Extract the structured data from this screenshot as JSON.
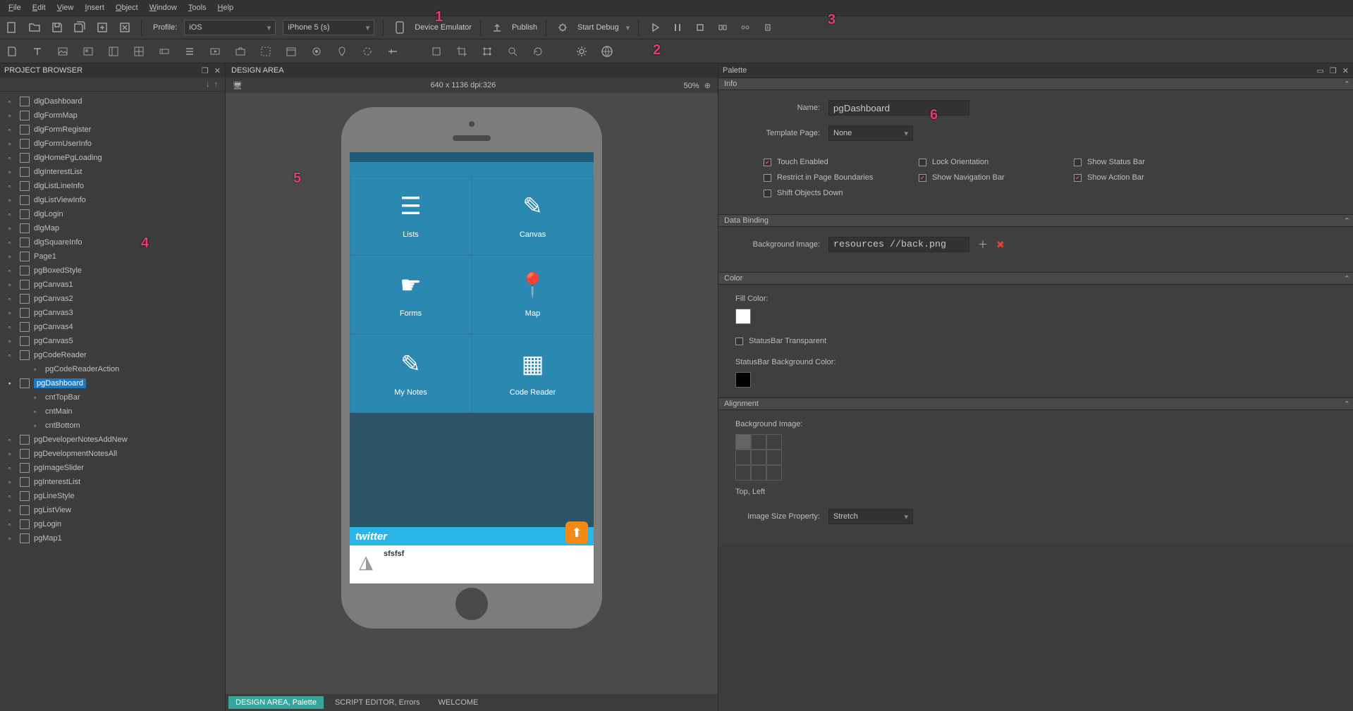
{
  "menubar": [
    "File",
    "Edit",
    "View",
    "Insert",
    "Object",
    "Window",
    "Tools",
    "Help"
  ],
  "toolbar": {
    "profile_label": "Profile:",
    "os": "iOS",
    "device": "iPhone 5 (s)",
    "emulator": "Device Emulator",
    "publish": "Publish",
    "start_debug": "Start Debug"
  },
  "markers": {
    "m1": "1",
    "m2": "2",
    "m3": "3",
    "m4": "4",
    "m5": "5",
    "m6": "6"
  },
  "project_browser": {
    "title": "PROJECT BROWSER",
    "items": [
      "dlgDashboard",
      "dlgFormMap",
      "dlgFormRegister",
      "dlgFormUserInfo",
      "dlgHomePgLoading",
      "dlgInterestList",
      "dlgListLineInfo",
      "dlgListViewInfo",
      "dlgLogin",
      "dlgMap",
      "dlgSquareInfo",
      "Page1",
      "pgBoxedStyle",
      "pgCanvas1",
      "pgCanvas2",
      "pgCanvas3",
      "pgCanvas4",
      "pgCanvas5",
      "pgCodeReader"
    ],
    "code_reader_child": "pgCodeReaderAction",
    "selected": "pgDashboard",
    "selected_children": [
      "cntTopBar",
      "cntMain",
      "cntBottom"
    ],
    "items_after": [
      "pgDeveloperNotesAddNew",
      "pgDevelopmentNotesAll",
      "pgImageSlider",
      "pgInterestList",
      "pgLineStyle",
      "pgListView",
      "pgLogin",
      "pgMap1"
    ]
  },
  "design_area": {
    "title": "DESIGN AREA",
    "resolution": "640 x 1136 dpi:326",
    "zoom": "50%",
    "tiles": [
      {
        "label": "Lists",
        "icon": "☰"
      },
      {
        "label": "Canvas",
        "icon": "✎"
      },
      {
        "label": "Forms",
        "icon": "☛"
      },
      {
        "label": "Map",
        "icon": "📍"
      },
      {
        "label": "My Notes",
        "icon": "✎"
      },
      {
        "label": "Code Reader",
        "icon": "▦"
      }
    ],
    "twitter_label": "twitter",
    "tweet_text": "sfsfsf"
  },
  "bottom_tabs": {
    "active": "DESIGN AREA, Palette",
    "tabs": [
      "SCRIPT EDITOR, Errors",
      "WELCOME"
    ]
  },
  "palette": {
    "title": "Palette",
    "info": {
      "section": "Info",
      "name_label": "Name:",
      "name_value": "pgDashboard",
      "template_label": "Template Page:",
      "template_value": "None",
      "checks": [
        {
          "label": "Touch Enabled",
          "checked": true
        },
        {
          "label": "Lock Orientation",
          "checked": false
        },
        {
          "label": "Show Status Bar",
          "checked": false
        },
        {
          "label": "Restrict in Page Boundaries",
          "checked": false
        },
        {
          "label": "Show Navigation Bar",
          "checked": true
        },
        {
          "label": "Show Action Bar",
          "checked": true
        },
        {
          "label": "Shift Objects Down",
          "checked": false
        }
      ]
    },
    "data_binding": {
      "section": "Data Binding",
      "bg_label": "Background Image:",
      "bg_value": "resources //back.png"
    },
    "color": {
      "section": "Color",
      "fill_label": "Fill Color:",
      "fill_swatch": "#ffffff",
      "status_transparent": "StatusBar Transparent",
      "status_bg_label": "StatusBar Background Color:",
      "status_bg_swatch": "#000000"
    },
    "alignment": {
      "section": "Alignment",
      "bg_label": "Background Image:",
      "align_text": "Top, Left",
      "size_label": "Image Size Property:",
      "size_value": "Stretch"
    }
  }
}
